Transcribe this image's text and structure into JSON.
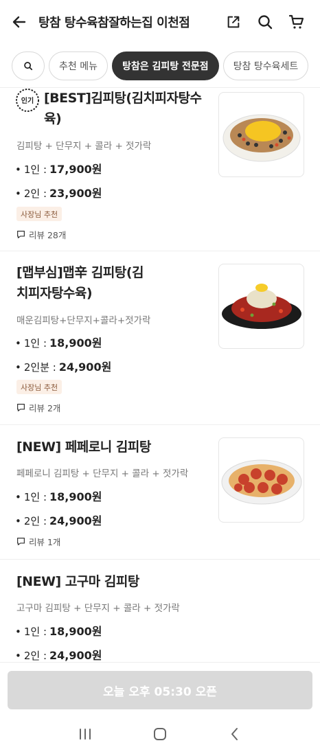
{
  "header": {
    "title": "탕참 탕수육참잘하는집 이천점",
    "icons": [
      "arrow-left-icon",
      "share-icon",
      "search-icon",
      "cart-icon"
    ]
  },
  "tabs": [
    {
      "label": "추천 메뉴",
      "active": false
    },
    {
      "label": "탕참은 김피탕 전문점",
      "active": true
    },
    {
      "label": "탕참 탕수육세트",
      "active": false
    }
  ],
  "items": [
    {
      "popular_label": "인기",
      "name": "[BEST]김피탕(김치피자탕수육)",
      "desc": "김피탕 + 단무지 + 콜라 + 젓가락",
      "prices": [
        {
          "label": "1인 :",
          "amount": "17,900원"
        },
        {
          "label": "2인 :",
          "amount": "23,900원"
        }
      ],
      "owner_badge": "사장님 추천",
      "review": "리뷰 28개"
    },
    {
      "name": "[맵부심]맵辛 김피탕(김치피자탕수육)",
      "desc": "매운김피탕+단무지+콜라+젓가락",
      "prices": [
        {
          "label": "1인 :",
          "amount": "18,900원"
        },
        {
          "label": "2인분 :",
          "amount": "24,900원"
        }
      ],
      "owner_badge": "사장님 추천",
      "review": "리뷰 2개"
    },
    {
      "name": "[NEW] 페페로니 김피탕",
      "desc": "페페로니 김피탕 + 단무지 + 콜라 + 젓가락",
      "prices": [
        {
          "label": "1인 :",
          "amount": "18,900원"
        },
        {
          "label": "2인 :",
          "amount": "24,900원"
        }
      ],
      "review": "리뷰 1개"
    },
    {
      "name": "[NEW] 고구마 김피탕",
      "desc": "고구마 김피탕 + 단무지 + 콜라 + 젓가락",
      "prices": [
        {
          "label": "1인 :",
          "amount": "18,900원"
        },
        {
          "label": "2인 :",
          "amount": "24,900원"
        }
      ]
    }
  ],
  "bottom": {
    "open_label": "오늘 오후 05:30 오픈"
  },
  "colors": {
    "active_chip": "#333333",
    "owner_badge_bg": "#fbefe6",
    "owner_badge_text": "#8a5a3b",
    "disabled_button": "#d9d9d9"
  }
}
